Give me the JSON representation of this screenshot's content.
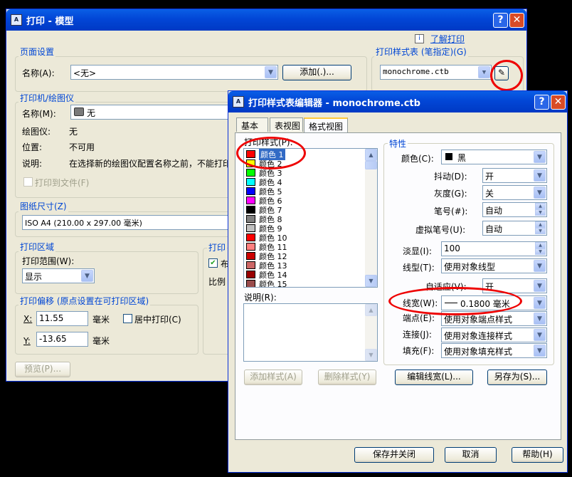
{
  "main": {
    "title": "打印 - 模型",
    "help_btn": "?",
    "close_btn": "✕",
    "learn_link": "了解打印",
    "page_setup": {
      "group": "页面设置",
      "name_label": "名称(A):",
      "name_value": "<无>",
      "add_button": "添加(.)..."
    },
    "style_table": {
      "group": "打印样式表 (笔指定)(G)",
      "value": "monochrome.ctb"
    },
    "printer": {
      "group": "打印机/绘图仪",
      "name_label": "名称(M):",
      "name_value": "无",
      "plotter_label": "绘图仪:",
      "plotter_value": "无",
      "location_label": "位置:",
      "location_value": "不可用",
      "desc_label": "说明:",
      "desc_value": "在选择新的绘图仪配置名称之前，不能打印",
      "print_to_file": "打印到文件(F)"
    },
    "paper": {
      "group": "图纸尺寸(Z)",
      "value": "ISO A4 (210.00 x 297.00 毫米)"
    },
    "area": {
      "group": "打印区域",
      "range_label": "打印范围(W):",
      "range_value": "显示"
    },
    "offset": {
      "group": "打印偏移 (原点设置在可打印区域)",
      "x_label": "X:",
      "x_value": "11.55",
      "x_unit": "毫米",
      "y_label": "Y:",
      "y_value": "-13.65",
      "y_unit": "毫米",
      "center": "居中打印(C)"
    },
    "scale": {
      "group": "打印",
      "fit_label": "布",
      "ratio_label": "比例"
    },
    "preview_button": "预览(P)..."
  },
  "editor": {
    "title": "打印样式表编辑器 - monochrome.ctb",
    "help_btn": "?",
    "close_btn": "✕",
    "tabs": [
      "基本",
      "表视图",
      "格式视图"
    ],
    "active_tab": 2,
    "styles_label": "打印样式(P):",
    "styles": [
      {
        "name": "颜色 1",
        "color": "#ff0000"
      },
      {
        "name": "颜色 2",
        "color": "#ffff00"
      },
      {
        "name": "颜色 3",
        "color": "#00ff00"
      },
      {
        "name": "颜色 4",
        "color": "#00ffff"
      },
      {
        "name": "颜色 5",
        "color": "#0000ff"
      },
      {
        "name": "颜色 6",
        "color": "#ff00ff"
      },
      {
        "name": "颜色 7",
        "color": "#000000"
      },
      {
        "name": "颜色 8",
        "color": "#808080"
      },
      {
        "name": "颜色 9",
        "color": "#c0c0c0"
      },
      {
        "name": "颜色 10",
        "color": "#ff0000"
      },
      {
        "name": "颜色 11",
        "color": "#ff7f7f"
      },
      {
        "name": "颜色 12",
        "color": "#cc0000"
      },
      {
        "name": "颜色 13",
        "color": "#cc6666"
      },
      {
        "name": "颜色 14",
        "color": "#990000"
      },
      {
        "name": "颜色 15",
        "color": "#994c4c"
      }
    ],
    "desc_label": "说明(R):",
    "add_style": "添加样式(A)",
    "delete_style": "删除样式(Y)",
    "props": {
      "group": "特性",
      "color_label": "颜色(C):",
      "color_value": "黑",
      "color_swatch": "#000000",
      "dither_label": "抖动(D):",
      "dither_value": "开",
      "grayscale_label": "灰度(G):",
      "grayscale_value": "关",
      "pen_label": "笔号(#):",
      "pen_value": "自动",
      "vpen_label": "虚拟笔号(U):",
      "vpen_value": "自动",
      "screening_label": "淡显(I):",
      "screening_value": "100",
      "linetype_label": "线型(T):",
      "linetype_value": "使用对象线型",
      "adaptive_label": "自适应(V):",
      "adaptive_value": "开",
      "lineweight_label": "线宽(W):",
      "lineweight_value": "0.1800 毫米",
      "endstyle_label": "端点(E):",
      "endstyle_value": "使用对象端点样式",
      "joinstyle_label": "连接(J):",
      "joinstyle_value": "使用对象连接样式",
      "fill_label": "填充(F):",
      "fill_value": "使用对象填充样式"
    },
    "edit_lineweights": "编辑线宽(L)...",
    "save_as": "另存为(S)...",
    "save_close": "保存并关闭",
    "cancel": "取消",
    "help": "帮助(H)"
  },
  "colors": {
    "accent": "#0046d5",
    "highlight": "#e00000"
  }
}
